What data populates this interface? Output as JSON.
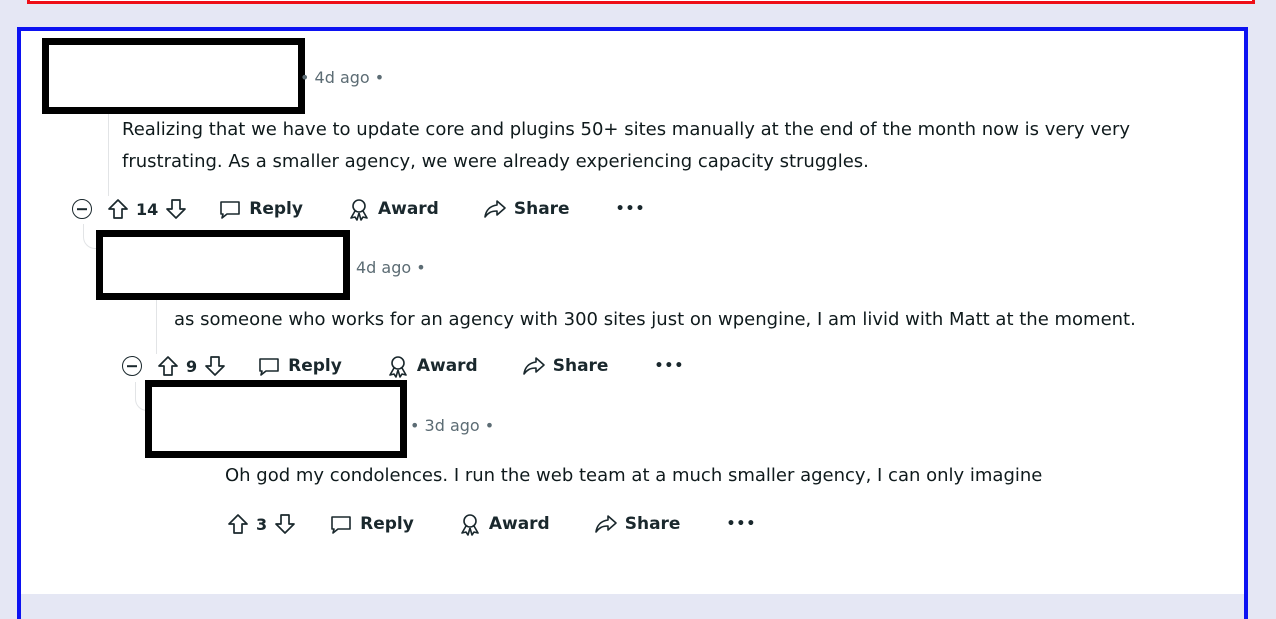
{
  "comments": [
    {
      "time": "4d ago",
      "text_line1": "Realizing that we have to update core and plugins 50+ sites manually at the end of the month now is very very",
      "text_line2": "frustrating. As a smaller agency, we were already experiencing capacity struggles.",
      "score": "14",
      "reply_label": "Reply",
      "award_label": "Award",
      "share_label": "Share",
      "more_label": "•••"
    },
    {
      "time": "4d ago",
      "text": "as someone who works for an agency with 300 sites just on wpengine, I am livid with Matt at the moment.",
      "score": "9",
      "reply_label": "Reply",
      "award_label": "Award",
      "share_label": "Share",
      "more_label": "•••"
    },
    {
      "time": "3d ago",
      "text": "Oh god my condolences. I run the web team at a much smaller agency, I can only imagine",
      "score": "3",
      "reply_label": "Reply",
      "award_label": "Award",
      "share_label": "Share",
      "more_label": "•••"
    }
  ],
  "meta_separator": "•",
  "colors": {
    "page_background": "#e5e7f4",
    "panel_border": "#0c12f2",
    "top_frame_border": "#ee0e17",
    "redaction": "#000000"
  }
}
